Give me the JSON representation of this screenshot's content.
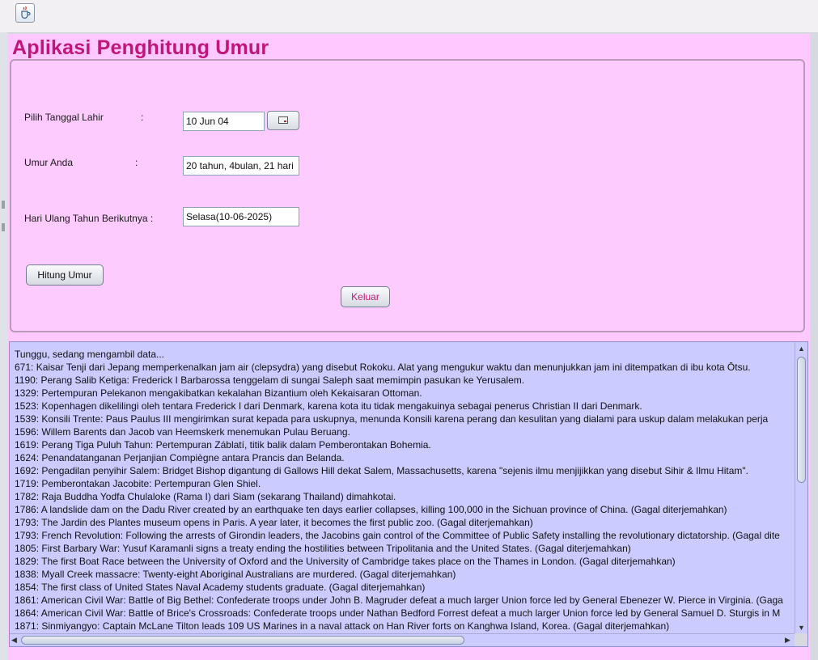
{
  "window": {
    "icon": "java-cup-icon"
  },
  "app": {
    "title": "Aplikasi Penghitung Umur"
  },
  "form": {
    "birthdate_label": "Pilih Tanggal Lahir",
    "birthdate_colon": ":",
    "birthdate_value": "10 Jun 04",
    "calendar_button_icon": "calendar-icon",
    "age_label": "Umur Anda",
    "age_colon": ":",
    "age_value": "20 tahun, 4bulan, 21 hari",
    "next_birthday_label": "Hari Ulang Tahun Berikutnya :",
    "next_birthday_value": "Selasa(10-06-2025)",
    "calculate_button": "Hitung Umur",
    "exit_button": "Keluar"
  },
  "colors": {
    "frame_background": "#ffc9ff",
    "title_color": "#c0157a",
    "log_background": "#cbcbff",
    "exit_text": "#c0157a"
  },
  "log": {
    "lines": [
      "Tunggu, sedang mengambil data...",
      "671: Kaisar Tenji dari Jepang memperkenalkan jam air (clepsydra) yang disebut Rokoku. Alat yang mengukur waktu dan menunjukkan jam ini ditempatkan di ibu kota Ōtsu.",
      "1190: Perang Salib Ketiga: Frederick I Barbarossa tenggelam di sungai Saleph saat memimpin pasukan ke Yerusalem.",
      "1329: Pertempuran Pelekanon mengakibatkan kekalahan Bizantium oleh Kekaisaran Ottoman.",
      "1523: Kopenhagen dikelilingi oleh tentara Frederick I dari Denmark, karena kota itu tidak mengakuinya sebagai penerus Christian II dari Denmark.",
      "1539: Konsili Trente: Paus Paulus III mengirimkan surat kepada para uskupnya, menunda Konsili karena perang dan kesulitan yang dialami para uskup dalam melakukan perja",
      "1596: Willem Barents dan Jacob van Heemskerk menemukan Pulau Beruang.",
      "1619: Perang Tiga Puluh Tahun: Pertempuran Záblatí, titik balik dalam Pemberontakan Bohemia.",
      "1624: Penandatanganan Perjanjian Compiègne antara Prancis dan Belanda.",
      "1692: Pengadilan penyihir Salem: Bridget Bishop digantung di Gallows Hill dekat Salem, Massachusetts, karena \"sejenis ilmu menjijikkan yang disebut Sihir & Ilmu Hitam\".",
      "1719: Pemberontakan Jacobite: Pertempuran Glen Shiel.",
      "1782: Raja Buddha Yodfa Chulaloke (Rama I) dari Siam (sekarang Thailand) dimahkotai.",
      "1786: A landslide dam on the Dadu River created by an earthquake ten days earlier collapses, killing 100,000 in the Sichuan province of China. (Gagal diterjemahkan)",
      "1793: The Jardin des Plantes museum opens in Paris. A year later, it becomes the first public zoo. (Gagal diterjemahkan)",
      "1793: French Revolution: Following the arrests of Girondin leaders, the Jacobins gain control of the Committee of Public Safety installing the revolutionary dictatorship. (Gagal dite",
      "1805: First Barbary War: Yusuf Karamanli signs a treaty ending the hostilities between Tripolitania and the United States. (Gagal diterjemahkan)",
      "1829: The first Boat Race between the University of Oxford and the University of Cambridge takes place on the Thames in London. (Gagal diterjemahkan)",
      "1838: Myall Creek massacre: Twenty-eight Aboriginal Australians are murdered. (Gagal diterjemahkan)",
      "1854: The first class of United States Naval Academy students graduate. (Gagal diterjemahkan)",
      "1861: American Civil War: Battle of Big Bethel: Confederate troops under John B. Magruder defeat a much larger Union force led by General Ebenezer W. Pierce in Virginia. (Gaga",
      "1864: American Civil War: Battle of Brice's Crossroads: Confederate troops under Nathan Bedford Forrest defeat a much larger Union force led by General Samuel D. Sturgis in M",
      "1871: Sinmiyangyo: Captain McLane Tilton leads 109 US Marines in a naval attack on Han River forts on Kanghwa Island, Korea. (Gagal diterjemahkan)"
    ]
  }
}
